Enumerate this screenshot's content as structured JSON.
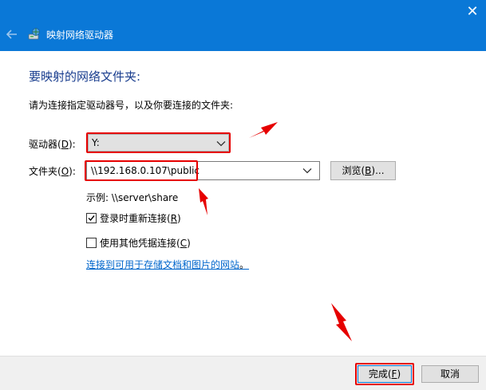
{
  "window": {
    "title": "映射网络驱动器",
    "close_glyph": "✕"
  },
  "main": {
    "heading": "要映射的网络文件夹:",
    "instruction": "请为连接指定驱动器号，以及你要连接的文件夹:",
    "drive": {
      "label_prefix": "驱动器(",
      "label_key": "D",
      "label_suffix": "):",
      "value": "Y:"
    },
    "folder": {
      "label_prefix": "文件夹(",
      "label_key": "O",
      "label_suffix": "):",
      "value": "\\\\192.168.0.107\\public"
    },
    "browse": {
      "prefix": "浏览(",
      "key": "B",
      "suffix": ")..."
    },
    "example": "示例: \\\\server\\share",
    "reconnect": {
      "checked": true,
      "prefix": "登录时重新连接(",
      "key": "R",
      "suffix": ")"
    },
    "other_creds": {
      "checked": false,
      "prefix": "使用其他凭据连接(",
      "key": "C",
      "suffix": ")"
    },
    "link": "连接到可用于存储文档和图片的网站",
    "link_tail": "。"
  },
  "footer": {
    "finish": {
      "prefix": "完成(",
      "key": "F",
      "suffix": ")"
    },
    "cancel": "取消"
  },
  "colors": {
    "titlebar": "#0a78d7",
    "heading": "#1a3e8f",
    "highlight": "#e60000",
    "link": "#0066cc"
  },
  "icons": {
    "back": "back-arrow-icon",
    "wizard": "network-drive-icon",
    "close": "close-icon",
    "dropdown": "chevron-down-icon",
    "check": "checkmark-icon"
  }
}
